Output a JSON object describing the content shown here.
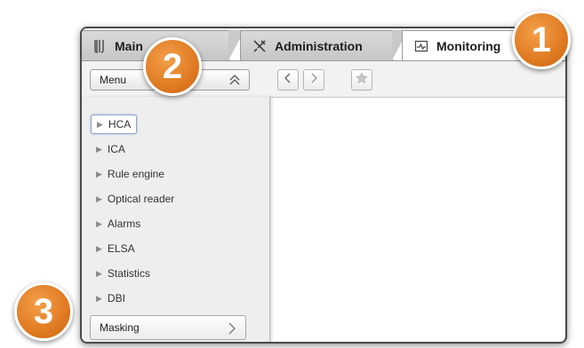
{
  "tabs": {
    "main_label": "Main",
    "admin_label": "Administration",
    "monitoring_label": "Monitoring",
    "main_icon": "beaker-icon",
    "admin_icon": "tools-icon",
    "monitoring_icon": "monitor-chart-icon"
  },
  "toolbar": {
    "menu_label": "Menu",
    "menu_chevron_icon": "double-chevron-up-icon",
    "back_icon": "chevron-left-icon",
    "forward_icon": "chevron-right-icon",
    "favorite_icon": "star-icon"
  },
  "menu": {
    "items": [
      {
        "label": "HCA",
        "selected": true
      },
      {
        "label": "ICA"
      },
      {
        "label": "Rule engine"
      },
      {
        "label": "Optical reader"
      },
      {
        "label": "Alarms"
      },
      {
        "label": "ELSA"
      },
      {
        "label": "Statistics"
      },
      {
        "label": "DBI"
      }
    ],
    "masking_label": "Masking"
  },
  "callouts": [
    "1",
    "2",
    "3"
  ],
  "colors": {
    "callout": "#e07a22",
    "selected_border": "#8fa6c9"
  }
}
